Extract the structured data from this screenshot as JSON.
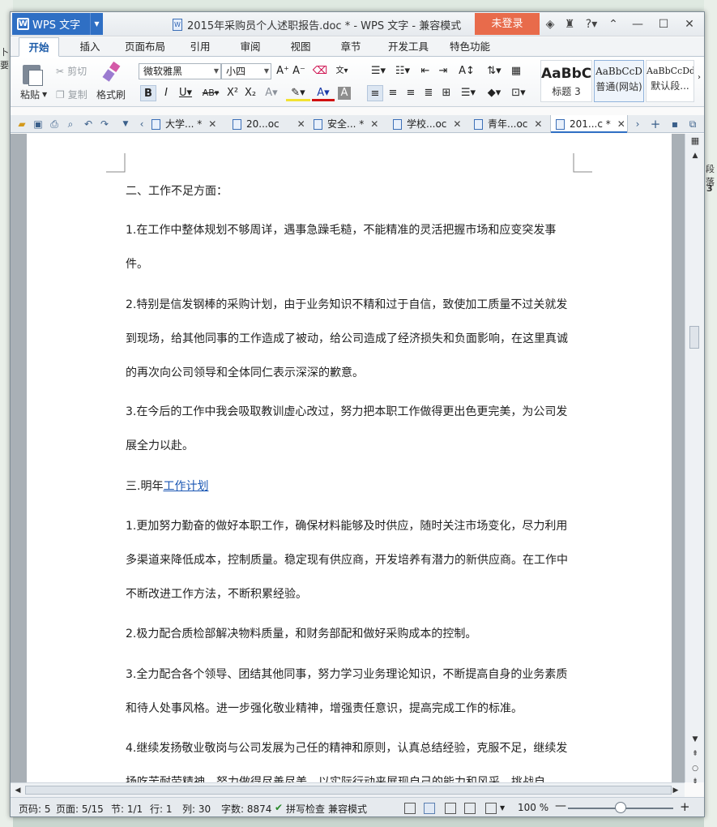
{
  "background": {
    "left_frag1": "卜要",
    "right_frag1": "段落",
    "right_frag2": "3"
  },
  "titlebar": {
    "app_button": "WPS 文字",
    "title": "2015年采购员个人述职报告.doc * - WPS 文字 - 兼容模式",
    "login_button": "未登录"
  },
  "ribbon_tabs": [
    "开始",
    "插入",
    "页面布局",
    "引用",
    "审阅",
    "视图",
    "章节",
    "开发工具",
    "特色功能"
  ],
  "ribbon": {
    "paste": "粘贴",
    "cut": "剪切",
    "copy": "复制",
    "format_painter": "格式刷",
    "font_name": "微软雅黑",
    "font_size": "小四",
    "styles": [
      {
        "sample": "AaBbC",
        "name": "标题 3"
      },
      {
        "sample": "AaBbCcD",
        "name": "普通(网站)"
      },
      {
        "sample": "AaBbCcDd",
        "name": "默认段..."
      }
    ]
  },
  "doc_tabs": [
    {
      "label": "大学... *"
    },
    {
      "label": "20...oc"
    },
    {
      "label": "安全... *"
    },
    {
      "label": "学校...oc"
    },
    {
      "label": "青年...oc"
    },
    {
      "label": "201...c *"
    }
  ],
  "document": {
    "h2": "二、工作不足方面：",
    "p1": "1.在工作中整体规划不够周详，遇事急躁毛糙，不能精准的灵活把握市场和应变突发事件。",
    "p2": "2.特别是信发钢棒的采购计划，由于业务知识不精和过于自信，致使加工质量不过关就发到现场，给其他同事的工作造成了被动，给公司造成了经济损失和负面影响，在这里真诚的再次向公司领导和全体同仁表示深深的歉意。",
    "p3": "3.在今后的工作中我会吸取教训虚心改过，努力把本职工作做得更出色更完美，为公司发展全力以赴。",
    "h3_prefix": "三.明年",
    "h3_link": "工作计划",
    "p4": "1.更加努力勤奋的做好本职工作，确保材料能够及时供应，随时关注市场变化，尽力利用多渠道来降低成本，控制质量。稳定现有供应商，开发培养有潜力的新供应商。在工作中不断改进工作方法，不断积累经验。",
    "p5": "2.极力配合质检部解决物料质量，和财务部配和做好采购成本的控制。",
    "p6": "3.全力配合各个领导、团结其他同事，努力学习业务理论知识，不断提高自身的业务素质和待人处事风格。进一步强化敬业精神，增强责任意识，提高完成工作的标准。",
    "p7": "4.继续发扬敬业敬岗与公司发展为己任的精神和原则，认真总结经验，克服不足，继续发扬吃苦耐劳精神，努力做得尽善尽美，以实际行动来展现自己的能力和风采，挑战自"
  },
  "statusbar": {
    "page_num": "页码: 5",
    "page_of": "页面: 5/15",
    "section": "节: 1/1",
    "row": "行: 1",
    "col": "列: 30",
    "word_count": "字数: 8874",
    "spellcheck": "拼写检查",
    "compat": "兼容模式",
    "zoom": "100 %",
    "zoom_level": 0.5
  },
  "colors": {
    "accent": "#2f6fc4",
    "login": "#e86b4b",
    "link": "#1a56b3"
  }
}
